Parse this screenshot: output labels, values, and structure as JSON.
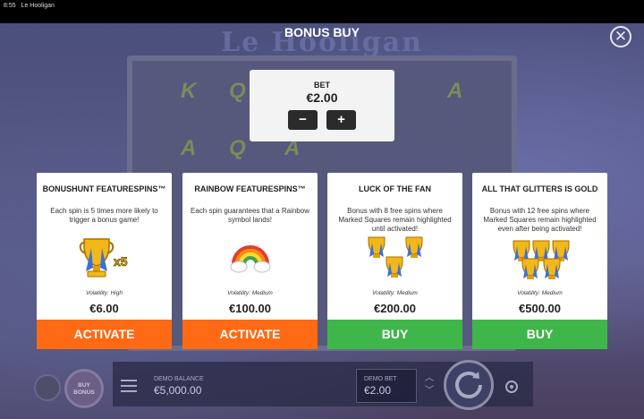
{
  "status_bar": {
    "time": "8:55",
    "app_name": "Le Hooligan"
  },
  "background": {
    "logo_text": "Le Hooligan",
    "reel_symbols": [
      "K",
      "Q",
      "A",
      "A",
      "Q",
      "A"
    ]
  },
  "modal": {
    "title": "BONUS BUY",
    "close_icon": "close-x-icon"
  },
  "bet_panel": {
    "label": "BET",
    "value": "€2.00",
    "minus": "−",
    "plus": "+"
  },
  "cards": [
    {
      "title": "BONUSHUNT FEATURESPINS™",
      "description": "Each spin is 5 times more likely to trigger a bonus game!",
      "icon": "trophy-x5-icon",
      "multiplier": "x5",
      "volatility": "Volatility: High",
      "price": "€6.00",
      "action": "ACTIVATE",
      "action_color": "#ff6a14"
    },
    {
      "title": "RAINBOW FEATURESPINS™",
      "description": "Each spin guarantees that a Rainbow symbol lands!",
      "icon": "rainbow-icon",
      "volatility": "Volatility: Medium",
      "price": "€100.00",
      "action": "ACTIVATE",
      "action_color": "#ff6a14"
    },
    {
      "title": "LUCK OF THE FAN",
      "description": "Bonus with 8 free spins where Marked Squares remain highlighted until activated!",
      "icon": "three-trophies-icon",
      "volatility": "Volatility: Medium",
      "price": "€200.00",
      "action": "BUY",
      "action_color": "#3fb64a"
    },
    {
      "title": "ALL THAT GLITTERS IS GOLD",
      "description": "Bonus with 12 free spins where Marked Squares remain highlighted even after being activated!",
      "icon": "five-trophies-icon",
      "volatility": "Volatility: Medium",
      "price": "€500.00",
      "action": "BUY",
      "action_color": "#3fb64a"
    }
  ],
  "bottom_bar": {
    "buy_bonus": "BUY BONUS",
    "balance_label": "DEMO BALANCE",
    "balance_value": "€5,000.00",
    "demo_bet_label": "DEMO BET",
    "demo_bet_value": "€2.00"
  }
}
